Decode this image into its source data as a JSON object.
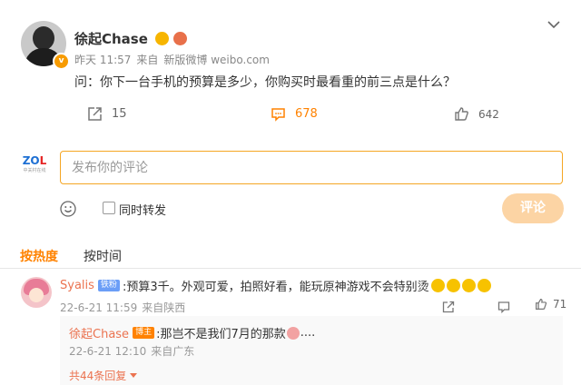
{
  "post": {
    "username": "徐起Chase",
    "verified_badge": "v",
    "time": "昨天 11:57",
    "source_prefix": "来自",
    "source": "新版微博 weibo.com",
    "text": "问：你下一台手机的预算是多少，你购买时最看重的前三点是什么？",
    "repost_count": "15",
    "comment_count": "678",
    "like_count": "642"
  },
  "composer": {
    "logo_text_blue": "ZO",
    "logo_text_red": "L",
    "logo_sub": "中关村在线",
    "placeholder": "发布你的评论",
    "forward_label": "同时转发",
    "submit_label": "评论"
  },
  "sort_tabs": [
    "按热度",
    "按时间"
  ],
  "comment": {
    "name": "Syalis",
    "fan_badge": "铁粉",
    "text": ":预算3千。外观可爱，拍照好看，能玩原神游戏不会特别烫",
    "date": "22-6-21 11:59",
    "location": "来自陕西",
    "like_count": "71",
    "reply": {
      "name": "徐起Chase",
      "author_badge": "博主",
      "text": ":那岂不是我们7月的那款",
      "trail": "....",
      "date": "22-6-21 12:10",
      "location": "来自广东"
    },
    "more_replies": "共44条回复"
  },
  "colors": {
    "accent": "#ff8200",
    "name_link": "#eb7350",
    "submit_disabled": "#fcd4a4"
  }
}
